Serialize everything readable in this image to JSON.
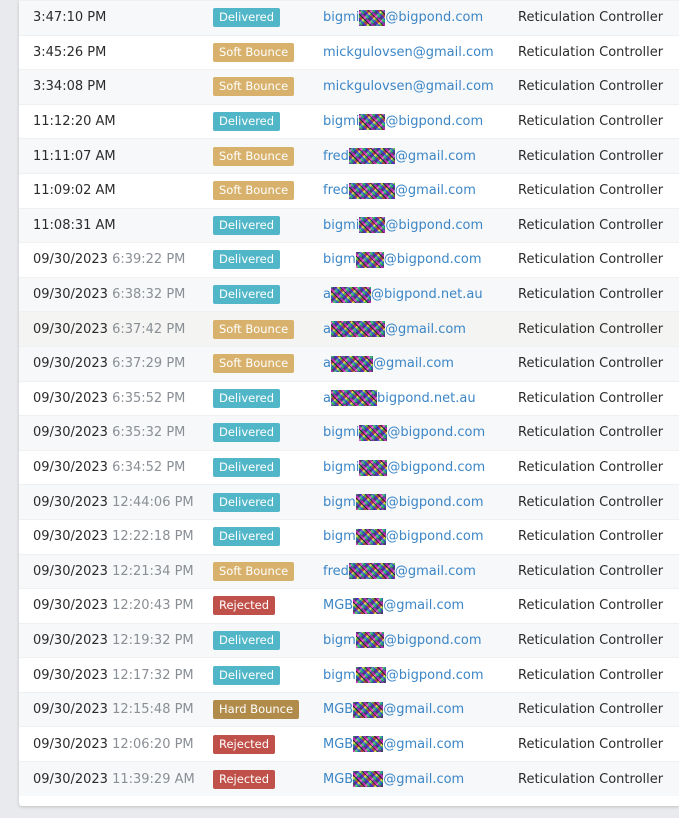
{
  "rows": [
    {
      "date": "",
      "time": "3:47:10 PM",
      "status": "Delivered",
      "email_pre": "bigmi",
      "email_post": "@bigpond.com",
      "subject": "Reticulation Controller"
    },
    {
      "date": "",
      "time": "3:45:26 PM",
      "status": "Soft Bounce",
      "email_pre": "mickgulovsen@gmail.com",
      "email_post": "",
      "subject": "Reticulation Controller"
    },
    {
      "date": "",
      "time": "3:34:08 PM",
      "status": "Soft Bounce",
      "email_pre": "mickgulovsen@gmail.com",
      "email_post": "",
      "subject": "Reticulation Controller"
    },
    {
      "date": "",
      "time": "11:12:20 AM",
      "status": "Delivered",
      "email_pre": "bigmi",
      "email_post": "@bigpond.com",
      "subject": "Reticulation Controller"
    },
    {
      "date": "",
      "time": "11:11:07 AM",
      "status": "Soft Bounce",
      "email_pre": "fred",
      "email_post": "@gmail.com",
      "subject": "Reticulation Controller"
    },
    {
      "date": "",
      "time": "11:09:02 AM",
      "status": "Soft Bounce",
      "email_pre": "fred",
      "email_post": "@gmail.com",
      "subject": "Reticulation Controller"
    },
    {
      "date": "",
      "time": "11:08:31 AM",
      "status": "Delivered",
      "email_pre": "bigmi",
      "email_post": "@bigpond.com",
      "subject": "Reticulation Controller"
    },
    {
      "date": "09/30/2023",
      "time": "6:39:22 PM",
      "status": "Delivered",
      "email_pre": "bigm",
      "email_post": "@bigpond.com",
      "subject": "Reticulation Controller"
    },
    {
      "date": "09/30/2023",
      "time": "6:38:32 PM",
      "status": "Delivered",
      "email_pre": "a",
      "email_post": "@bigpond.net.au",
      "subject": "Reticulation Controller"
    },
    {
      "date": "09/30/2023",
      "time": "6:37:42 PM",
      "status": "Soft Bounce",
      "email_pre": "a",
      "email_post": "@gmail.com",
      "subject": "Reticulation Controller"
    },
    {
      "date": "09/30/2023",
      "time": "6:37:29 PM",
      "status": "Soft Bounce",
      "email_pre": "a",
      "email_post": "@gmail.com",
      "subject": "Reticulation Controller"
    },
    {
      "date": "09/30/2023",
      "time": "6:35:52 PM",
      "status": "Delivered",
      "email_pre": "a",
      "email_post": "bigpond.net.au",
      "subject": "Reticulation Controller"
    },
    {
      "date": "09/30/2023",
      "time": "6:35:32 PM",
      "status": "Delivered",
      "email_pre": "bigmi",
      "email_post": "@bigpond.com",
      "subject": "Reticulation Controller"
    },
    {
      "date": "09/30/2023",
      "time": "6:34:52 PM",
      "status": "Delivered",
      "email_pre": "bigmi",
      "email_post": "@bigpond.com",
      "subject": "Reticulation Controller"
    },
    {
      "date": "09/30/2023",
      "time": "12:44:06 PM",
      "status": "Delivered",
      "email_pre": "bigm",
      "email_post": "@bigpond.com",
      "subject": "Reticulation Controller"
    },
    {
      "date": "09/30/2023",
      "time": "12:22:18 PM",
      "status": "Delivered",
      "email_pre": "bigm",
      "email_post": "@bigpond.com",
      "subject": "Reticulation Controller"
    },
    {
      "date": "09/30/2023",
      "time": "12:21:34 PM",
      "status": "Soft Bounce",
      "email_pre": "fred",
      "email_post": "@gmail.com",
      "subject": "Reticulation Controller"
    },
    {
      "date": "09/30/2023",
      "time": "12:20:43 PM",
      "status": "Rejected",
      "email_pre": "MGB",
      "email_post": "@gmail.com",
      "subject": "Reticulation Controller"
    },
    {
      "date": "09/30/2023",
      "time": "12:19:32 PM",
      "status": "Delivered",
      "email_pre": "bigm",
      "email_post": "@bigpond.com",
      "subject": "Reticulation Controller"
    },
    {
      "date": "09/30/2023",
      "time": "12:17:32 PM",
      "status": "Delivered",
      "email_pre": "bigm",
      "email_post": "@bigpond.com",
      "subject": "Reticulation Controller"
    },
    {
      "date": "09/30/2023",
      "time": "12:15:48 PM",
      "status": "Hard Bounce",
      "email_pre": "MGB",
      "email_post": "@gmail.com",
      "subject": "Reticulation Controller"
    },
    {
      "date": "09/30/2023",
      "time": "12:06:20 PM",
      "status": "Rejected",
      "email_pre": "MGB",
      "email_post": "@gmail.com",
      "subject": "Reticulation Controller"
    },
    {
      "date": "09/30/2023",
      "time": "11:39:29 AM",
      "status": "Rejected",
      "email_pre": "MGB",
      "email_post": "@gmail.com",
      "subject": "Reticulation Controller"
    }
  ],
  "status_colors": {
    "Delivered": "#51b7c8",
    "Soft Bounce": "#d8b26c",
    "Rejected": "#c0514a",
    "Hard Bounce": "#b18b4a"
  },
  "link_color": "#3c86c6"
}
